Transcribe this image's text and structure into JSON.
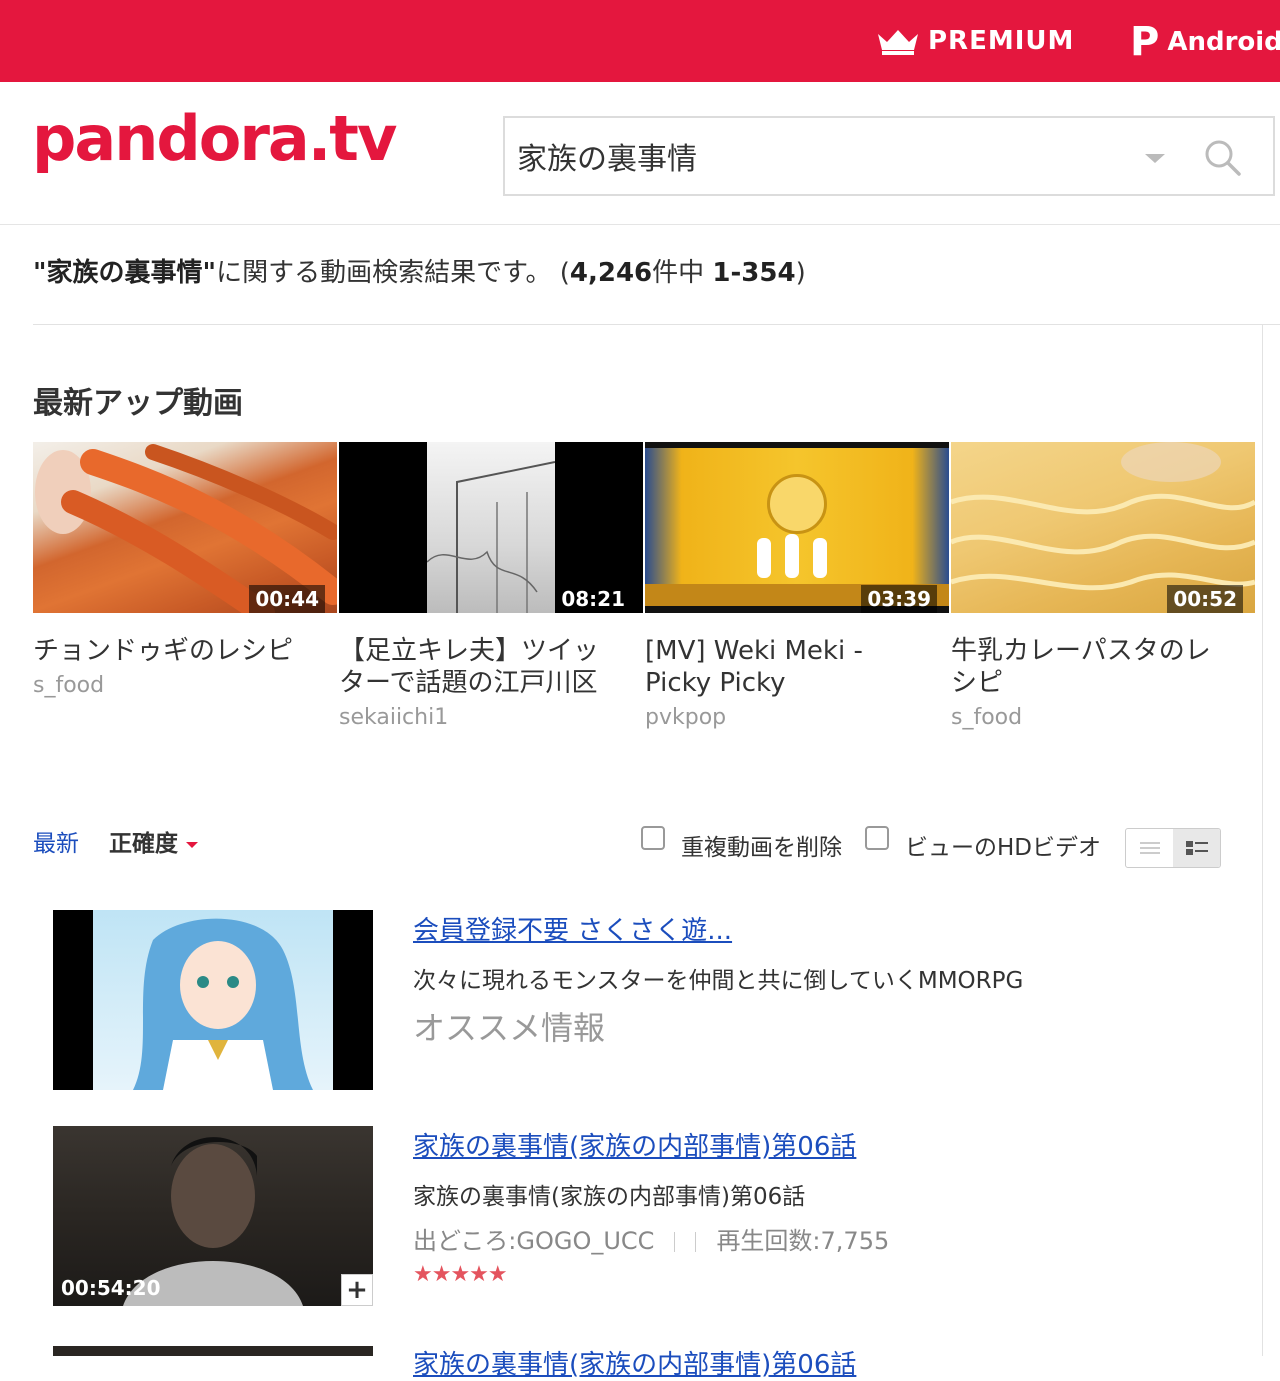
{
  "topbar": {
    "premium_label": "PREMIUM",
    "android_label": "Android ",
    "android_p": "P"
  },
  "header": {
    "logo_text": "pandora.tv",
    "search_value": "家族の裏事情"
  },
  "results": {
    "query_quoted": "\"家族の裏事情\"",
    "text_after": "に関する動画検索結果です。 (",
    "total": "4,246",
    "mid": "件中 ",
    "range": "1-354",
    "close": ")"
  },
  "latest": {
    "heading": "最新アップ動画",
    "cards": [
      {
        "title": "チョンドゥギのレシピ",
        "user": "s_food",
        "duration": "00:44"
      },
      {
        "title": "【足立キレ夫】ツイッターで話題の江戸川区",
        "user": "sekaiichi1",
        "duration": "08:21"
      },
      {
        "title": "[MV] Weki Meki - Picky Picky",
        "user": "pvkpop",
        "duration": "03:39"
      },
      {
        "title": "牛乳カレーパスタのレシピ",
        "user": "s_food",
        "duration": "00:52"
      }
    ]
  },
  "sortbar": {
    "latest": "最新",
    "accuracy": "正確度",
    "dedupe": "重複動画を削除",
    "hd": "ビューのHDビデオ"
  },
  "items": [
    {
      "title": "会員登録不要 さくさく遊...",
      "desc": "次々に現れるモンスターを仲間と共に倒していくMMORPG",
      "ad_label": "オススメ情報"
    },
    {
      "title": "家族の裏事情(家族の内部事情)第06話",
      "desc": "家族の裏事情(家族の内部事情)第06話",
      "source": "出どころ:GOGO_UCC",
      "views": "再生回数:7,755",
      "duration": "00:54:20",
      "stars": "★★★★★",
      "plus": "+"
    },
    {
      "title": "家族の裏事情(家族の内部事情)第06話"
    }
  ],
  "colors": {
    "brand": "#e4173e",
    "link": "#1b4dbd"
  }
}
